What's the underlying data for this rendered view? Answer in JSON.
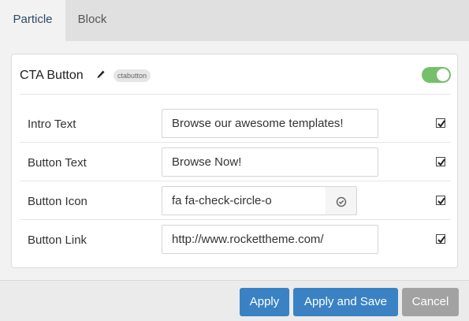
{
  "tabs": [
    {
      "label": "Particle",
      "active": true
    },
    {
      "label": "Block",
      "active": false
    }
  ],
  "card": {
    "title": "CTA Button",
    "badge": "ctabutton",
    "enabled": true,
    "edit_icon": "pencil-icon"
  },
  "fields": [
    {
      "label": "Intro Text",
      "value": "Browse our awesome templates!",
      "checked": true
    },
    {
      "label": "Button Text",
      "value": "Browse Now!",
      "checked": true
    },
    {
      "label": "Button Icon",
      "value": "fa fa-check-circle-o",
      "checked": true,
      "picker_icon": "check-circle-icon"
    },
    {
      "label": "Button Link",
      "value": "http://www.rockettheme.com/",
      "checked": true
    }
  ],
  "footer": {
    "apply_label": "Apply",
    "apply_save_label": "Apply and Save",
    "cancel_label": "Cancel"
  },
  "colors": {
    "primary": "#3a82c4",
    "toggle_on": "#74c06b",
    "cancel": "#a2a2a2",
    "active_tab_text": "#2b4b66"
  }
}
